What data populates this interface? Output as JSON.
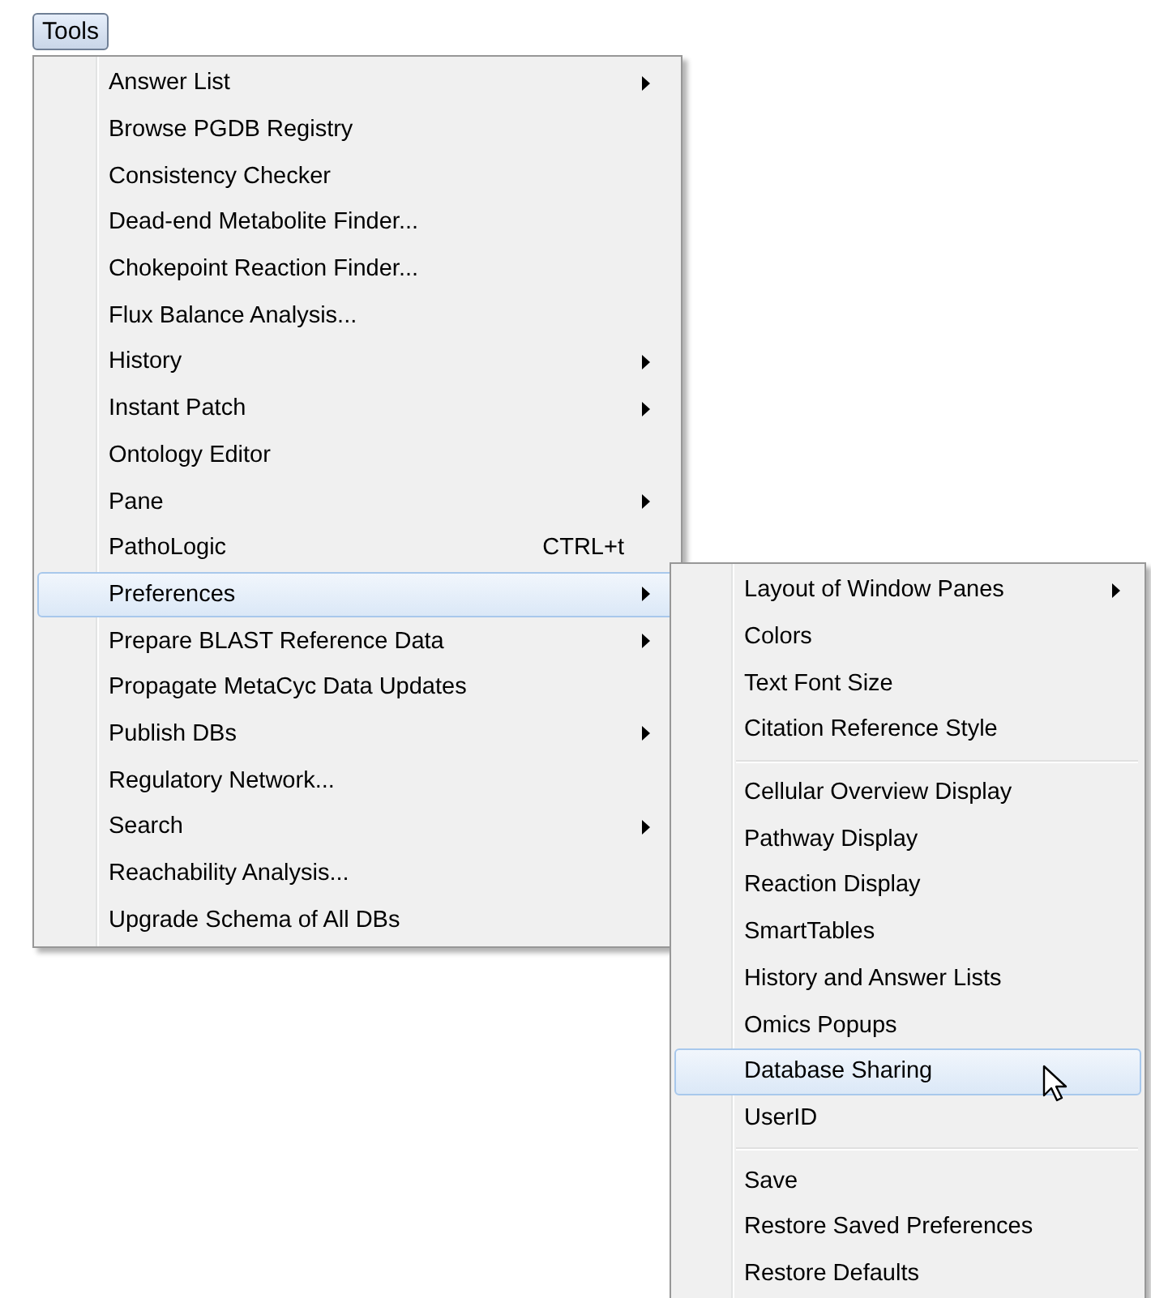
{
  "menu_bar": [
    {
      "label": "Tools",
      "selected": true
    }
  ],
  "tools_menu": {
    "items": [
      {
        "label": "Answer List",
        "submenu": true,
        "selected": false
      },
      {
        "label": "Browse PGDB Registry",
        "submenu": false,
        "selected": false
      },
      {
        "label": "Consistency Checker",
        "submenu": false,
        "selected": false
      },
      {
        "label": "Dead-end Metabolite Finder...",
        "submenu": false,
        "selected": false
      },
      {
        "label": "Chokepoint Reaction Finder...",
        "submenu": false,
        "selected": false
      },
      {
        "label": "Flux Balance Analysis...",
        "submenu": false,
        "selected": false
      },
      {
        "label": "History",
        "submenu": true,
        "selected": false
      },
      {
        "label": "Instant Patch",
        "submenu": true,
        "selected": false
      },
      {
        "label": "Ontology Editor",
        "submenu": false,
        "selected": false
      },
      {
        "label": "Pane",
        "submenu": true,
        "selected": false
      },
      {
        "label": "PathoLogic",
        "shortcut": "CTRL+t",
        "submenu": false,
        "selected": false
      },
      {
        "label": "Preferences",
        "submenu": true,
        "selected": true
      },
      {
        "label": "Prepare BLAST Reference Data",
        "submenu": true,
        "selected": false
      },
      {
        "label": "Propagate MetaCyc Data Updates",
        "submenu": false,
        "selected": false
      },
      {
        "label": "Publish DBs",
        "submenu": true,
        "selected": false
      },
      {
        "label": "Regulatory Network...",
        "submenu": false,
        "selected": false
      },
      {
        "label": "Search",
        "submenu": true,
        "selected": false
      },
      {
        "label": "Reachability Analysis...",
        "submenu": false,
        "selected": false
      },
      {
        "label": "Upgrade Schema of All DBs",
        "submenu": false,
        "selected": false
      }
    ]
  },
  "preferences_menu": {
    "groups": [
      [
        {
          "label": "Layout of Window Panes",
          "submenu": true,
          "selected": false
        },
        {
          "label": "Colors",
          "submenu": false,
          "selected": false
        },
        {
          "label": "Text Font Size",
          "submenu": false,
          "selected": false
        },
        {
          "label": "Citation Reference Style",
          "submenu": false,
          "selected": false
        }
      ],
      [
        {
          "label": "Cellular Overview Display",
          "submenu": false,
          "selected": false
        },
        {
          "label": "Pathway Display",
          "submenu": false,
          "selected": false
        },
        {
          "label": "Reaction Display",
          "submenu": false,
          "selected": false
        },
        {
          "label": "SmartTables",
          "submenu": false,
          "selected": false
        },
        {
          "label": "History and Answer Lists",
          "submenu": false,
          "selected": false
        },
        {
          "label": "Omics Popups",
          "submenu": false,
          "selected": false
        },
        {
          "label": "Database Sharing",
          "submenu": false,
          "selected": true
        },
        {
          "label": "UserID",
          "submenu": false,
          "selected": false
        }
      ],
      [
        {
          "label": "Save",
          "submenu": false,
          "selected": false
        },
        {
          "label": "Restore Saved Preferences",
          "submenu": false,
          "selected": false
        },
        {
          "label": "Restore Defaults",
          "submenu": false,
          "selected": false
        }
      ]
    ]
  }
}
